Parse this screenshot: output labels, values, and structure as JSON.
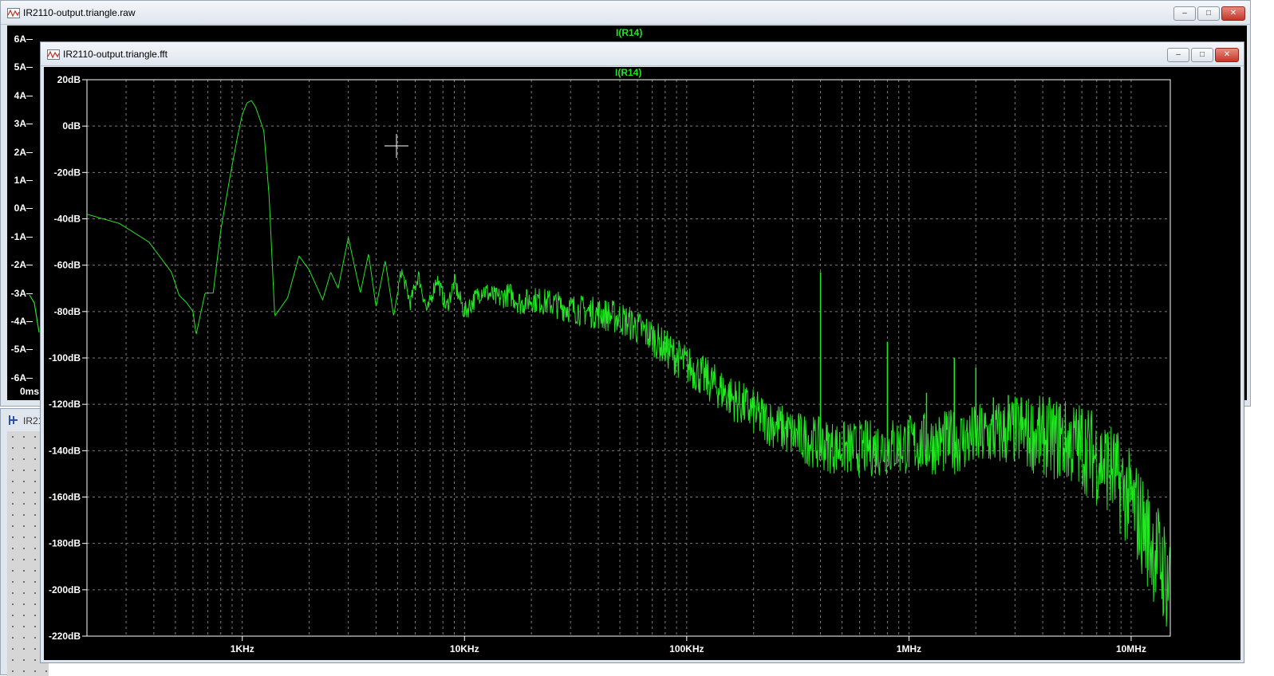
{
  "raw_window": {
    "title": "IR2110-output.triangle.raw",
    "trace_label": "I(R14)",
    "y_ticks": [
      "6A",
      "5A",
      "4A",
      "3A",
      "2A",
      "1A",
      "0A",
      "-1A",
      "-2A",
      "-3A",
      "-4A",
      "-5A",
      "-6A"
    ],
    "x_start": "0ms"
  },
  "schematic_window": {
    "title_fragment": "IR21"
  },
  "fft_window": {
    "title": "IR2110-output.triangle.fft",
    "trace_label": "I(R14)"
  },
  "window_buttons": {
    "minimize": "–",
    "maximize": "□",
    "close": "✕"
  },
  "colors": {
    "trace": "#22e622",
    "background": "#000000",
    "grid": "#7a7a7a"
  },
  "chart_data": {
    "type": "line",
    "title": "I(R14)",
    "xscale": "log",
    "xlim_hz": [
      200,
      15000000
    ],
    "ylim_db": [
      -220,
      20
    ],
    "x_tick_labels": [
      "1KHz",
      "10KHz",
      "100KHz",
      "1MHz",
      "10MHz"
    ],
    "y_tick_labels": [
      "20dB",
      "0dB",
      "-20dB",
      "-40dB",
      "-60dB",
      "-80dB",
      "-100dB",
      "-120dB",
      "-140dB",
      "-160dB",
      "-180dB",
      "-200dB",
      "-220dB"
    ],
    "grid": true,
    "series": [
      {
        "x_hz": [
          200,
          280,
          380,
          480,
          520,
          560,
          600,
          620,
          680,
          740,
          800,
          880,
          950,
          1000,
          1050,
          1100,
          1150,
          1250,
          1320,
          1400,
          1600,
          1800,
          2000,
          2300,
          2500,
          2700,
          3000,
          3400,
          3700,
          4000,
          4400,
          4800,
          5200,
          5700,
          6200,
          6800,
          7500,
          8300,
          9000,
          10000,
          12000,
          14000,
          16000,
          18000,
          20000,
          25000,
          30000,
          40000,
          50000,
          60000,
          70000,
          80000,
          100000,
          130000,
          170000,
          220000,
          300000,
          400000,
          500000,
          600000,
          800000,
          1000000,
          1500000,
          2000000,
          3000000,
          4000000,
          6000000,
          8000000,
          10000000,
          12000000,
          15000000
        ],
        "y_db": [
          -38,
          -42,
          -50,
          -63,
          -73,
          -76,
          -80,
          -90,
          -72,
          -72,
          -45,
          -22,
          -5,
          5,
          10,
          11,
          8,
          -2,
          -30,
          -82,
          -74,
          -56,
          -62,
          -75,
          -63,
          -70,
          -48,
          -72,
          -55,
          -78,
          -58,
          -82,
          -62,
          -76,
          -64,
          -80,
          -65,
          -78,
          -67,
          -80,
          -70,
          -74,
          -72,
          -76,
          -74,
          -76,
          -78,
          -80,
          -82,
          -86,
          -90,
          -95,
          -102,
          -110,
          -118,
          -125,
          -132,
          -136,
          -138,
          -138,
          -137,
          -136,
          -135,
          -133,
          -130,
          -132,
          -136,
          -145,
          -160,
          -175,
          -195
        ]
      }
    ],
    "spikes": [
      {
        "x_hz": 400000,
        "y_db": -63
      },
      {
        "x_hz": 800000,
        "y_db": -93
      },
      {
        "x_hz": 1200000,
        "y_db": -115
      },
      {
        "x_hz": 1600000,
        "y_db": -100
      },
      {
        "x_hz": 2000000,
        "y_db": -104
      },
      {
        "x_hz": 2400000,
        "y_db": -117
      },
      {
        "x_hz": 2800000,
        "y_db": -116
      },
      {
        "x_hz": 3200000,
        "y_db": -117
      },
      {
        "x_hz": 4000000,
        "y_db": -120
      },
      {
        "x_hz": 4800000,
        "y_db": -120
      },
      {
        "x_hz": 6000000,
        "y_db": -122
      }
    ]
  }
}
